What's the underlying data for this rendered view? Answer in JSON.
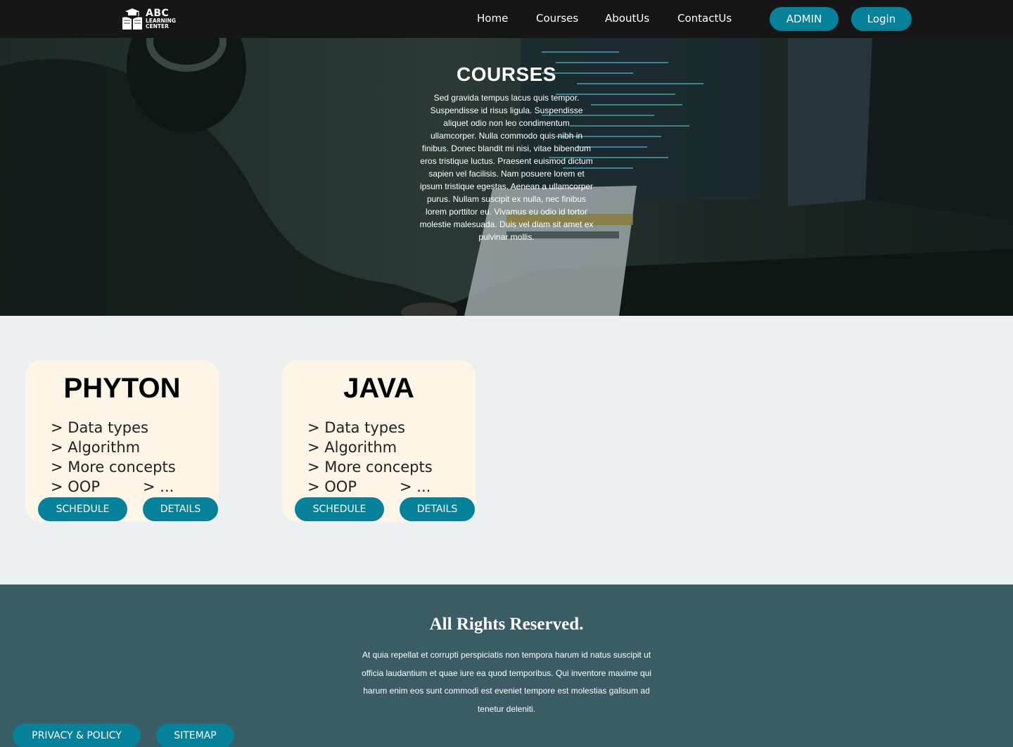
{
  "brand": {
    "name": "ABC",
    "subtitle_line1": "LEARNING",
    "subtitle_line2": "CENTER",
    "icon": "book-logo-icon"
  },
  "nav": {
    "home": "Home",
    "courses": "Courses",
    "about": "AboutUs",
    "contact": "ContactUs",
    "admin": "ADMIN",
    "login": "Login"
  },
  "hero": {
    "title": "COURSES",
    "text": "Sed gravida tempus lacus quis tempor. Suspendisse id risus ligula. Suspendisse aliquet odio non leo condimentum ullamcorper. Nulla commodo quis nibh in finibus. Donec blandit mi nisi, vitae bibendum eros tristique luctus. Praesent euismod dictum sapien vel facilisis. Nam posuere lorem et ipsum tristique egestas. Aenean a ullamcorper purus. Nullam suscipit ex nulla, nec finibus lorem porttitor eu. Vivamus eu odio id tortor molestie malesuada. Duis vel diam sit amet ex pulvinar mollis."
  },
  "courses": [
    {
      "title": "PHYTON",
      "topics": [
        "> Data types",
        "> Algorithm",
        "> More concepts",
        "> OOP"
      ],
      "more": "> ...",
      "schedule": "SCHEDULE",
      "details": "DETAILS"
    },
    {
      "title": "JAVA",
      "topics": [
        "> Data types",
        "> Algorithm",
        "> More concepts",
        "> OOP"
      ],
      "more": "> ...",
      "schedule": "SCHEDULE",
      "details": "DETAILS"
    }
  ],
  "footer": {
    "title": "All Rights Reserved.",
    "text": "At quia repellat et corrupti perspiciatis non tempora harum id natus suscipit ut officia laudantium et quae iure ea quod temporibus. Qui inventore maxime qui harum enim eos sunt commodi est eveniet tempore est molestias galisum ad tenetur deleniti.",
    "privacy": "PRIVACY & POLICY",
    "sitemap": "SITEMAP"
  },
  "colors": {
    "navbar": "#161616",
    "accent": "#05819a",
    "card": "#fdf5e6",
    "page": "#ecf0f1",
    "footer": "#3a5c65"
  }
}
